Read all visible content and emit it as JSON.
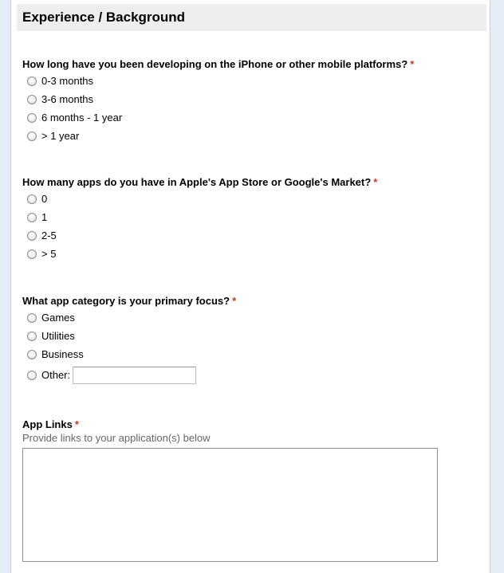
{
  "section": {
    "title": "Experience / Background"
  },
  "questions": [
    {
      "title": "How long have you been developing on the iPhone or other mobile platforms?",
      "required_mark": "*",
      "options": [
        "0-3 months",
        "3-6 months",
        "6 months - 1 year",
        "> 1 year"
      ]
    },
    {
      "title": "How many apps do you have in Apple's App Store or Google's Market?",
      "required_mark": "*",
      "options": [
        "0",
        "1",
        "2-5",
        "> 5"
      ]
    },
    {
      "title": "What app category is your primary focus?",
      "required_mark": "*",
      "options": [
        "Games",
        "Utilities",
        "Business",
        "Other:"
      ],
      "other_value": ""
    },
    {
      "title": "App Links",
      "required_mark": "*",
      "help_text": "Provide links to your application(s) below",
      "value": ""
    }
  ]
}
